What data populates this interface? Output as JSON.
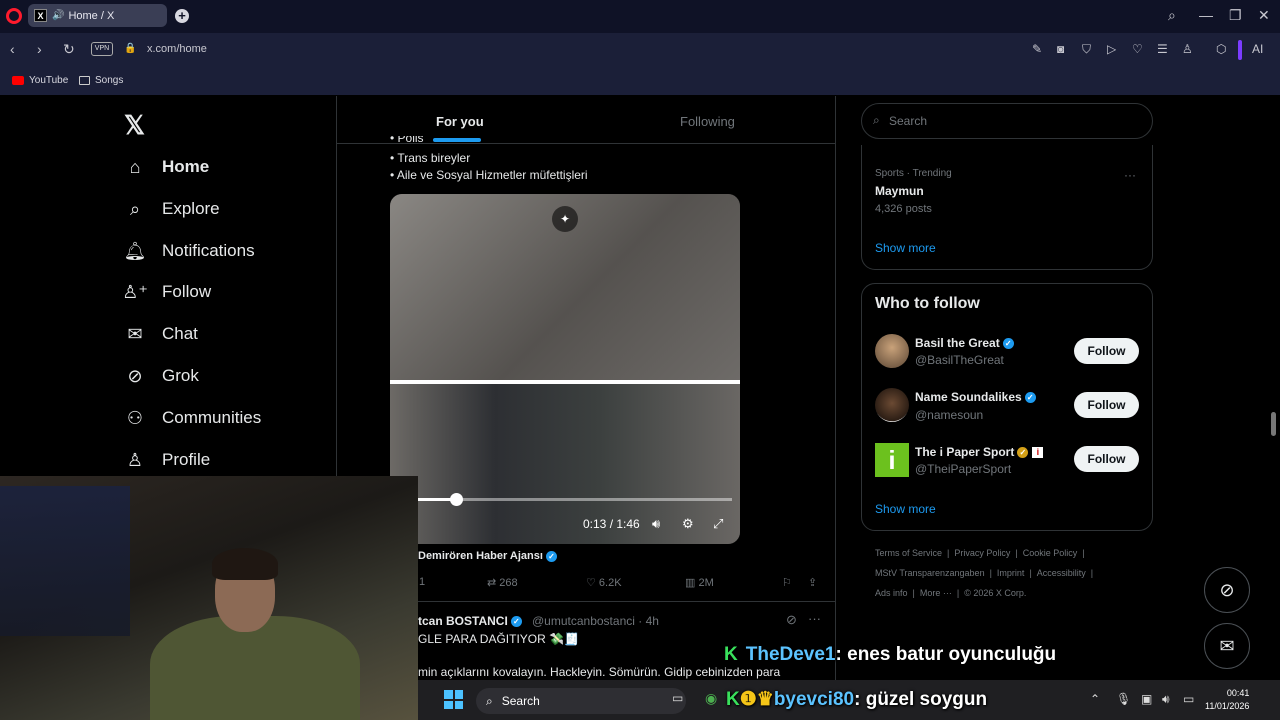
{
  "browser": {
    "tab_title": "Home / X",
    "url": "x.com/home",
    "vpn_label": "VPN",
    "ai_label": "AI",
    "bookmarks": [
      {
        "label": "YouTube",
        "icon": "youtube-icon"
      },
      {
        "label": "Songs",
        "icon": "folder-icon"
      }
    ]
  },
  "sidebar": {
    "items": [
      {
        "label": "Home",
        "icon": "home-icon",
        "active": true
      },
      {
        "label": "Explore",
        "icon": "search-icon"
      },
      {
        "label": "Notifications",
        "icon": "bell-icon"
      },
      {
        "label": "Follow",
        "icon": "follow-icon"
      },
      {
        "label": "Chat",
        "icon": "mail-icon"
      },
      {
        "label": "Grok",
        "icon": "grok-icon"
      },
      {
        "label": "Communities",
        "icon": "communities-icon"
      },
      {
        "label": "Profile",
        "icon": "profile-icon"
      }
    ]
  },
  "feed": {
    "tabs": [
      "For you",
      "Following"
    ],
    "post_lines": [
      "• Polis",
      "• Trans bireyler",
      "• Aile ve Sosyal Hizmetler müfettişleri"
    ],
    "video": {
      "time": "0:13 / 1:46",
      "progress": 0.123
    },
    "source": "Demirören Haber Ajansı",
    "actions": {
      "replies": "1",
      "reposts": "268",
      "likes": "6.2K",
      "views": "2M"
    },
    "post2": {
      "name": "tcan BOSTANCI",
      "handle": "@umutcanbostanci · 4h",
      "line1": "GLE PARA DAĞITIYOR 💸🧾",
      "line2": "min açıklarını kovalayın. Hackleyin. Sömürün. Gidip cebinizden para"
    }
  },
  "right": {
    "search_placeholder": "Search",
    "trend": {
      "category": "Sports · Trending",
      "name": "Maymun",
      "posts": "4,326 posts",
      "show_more": "Show more"
    },
    "who_to_follow": {
      "title": "Who to follow",
      "users": [
        {
          "name": "Basil the Great",
          "handle": "@BasilTheGreat",
          "button": "Follow",
          "badge": "blue"
        },
        {
          "name": "Name Soundalikes",
          "handle": "@namesoun",
          "button": "Follow",
          "badge": "blue"
        },
        {
          "name": "The i Paper Sport",
          "handle": "@TheiPaperSport",
          "button": "Follow",
          "badge": "gold"
        }
      ],
      "show_more": "Show more"
    },
    "footer": {
      "row1": [
        "Terms of Service",
        "|",
        "Privacy Policy",
        "|",
        "Cookie Policy",
        "|"
      ],
      "row2": [
        "MStV Transparenzangaben",
        "|",
        "Imprint",
        "|",
        "Accessibility",
        "|"
      ],
      "row3": [
        "Ads info",
        "|",
        "More ···",
        "|",
        "© 2026 X Corp."
      ]
    }
  },
  "overlay": {
    "chat1_user": "TheDeve1",
    "chat1_msg": ": enes batur oyunculuğu",
    "chat2_user": "byevci80",
    "chat2_msg": ": güzel soygun"
  },
  "taskbar": {
    "search": "Search",
    "time": "00:41",
    "date": "11/01/2026"
  }
}
